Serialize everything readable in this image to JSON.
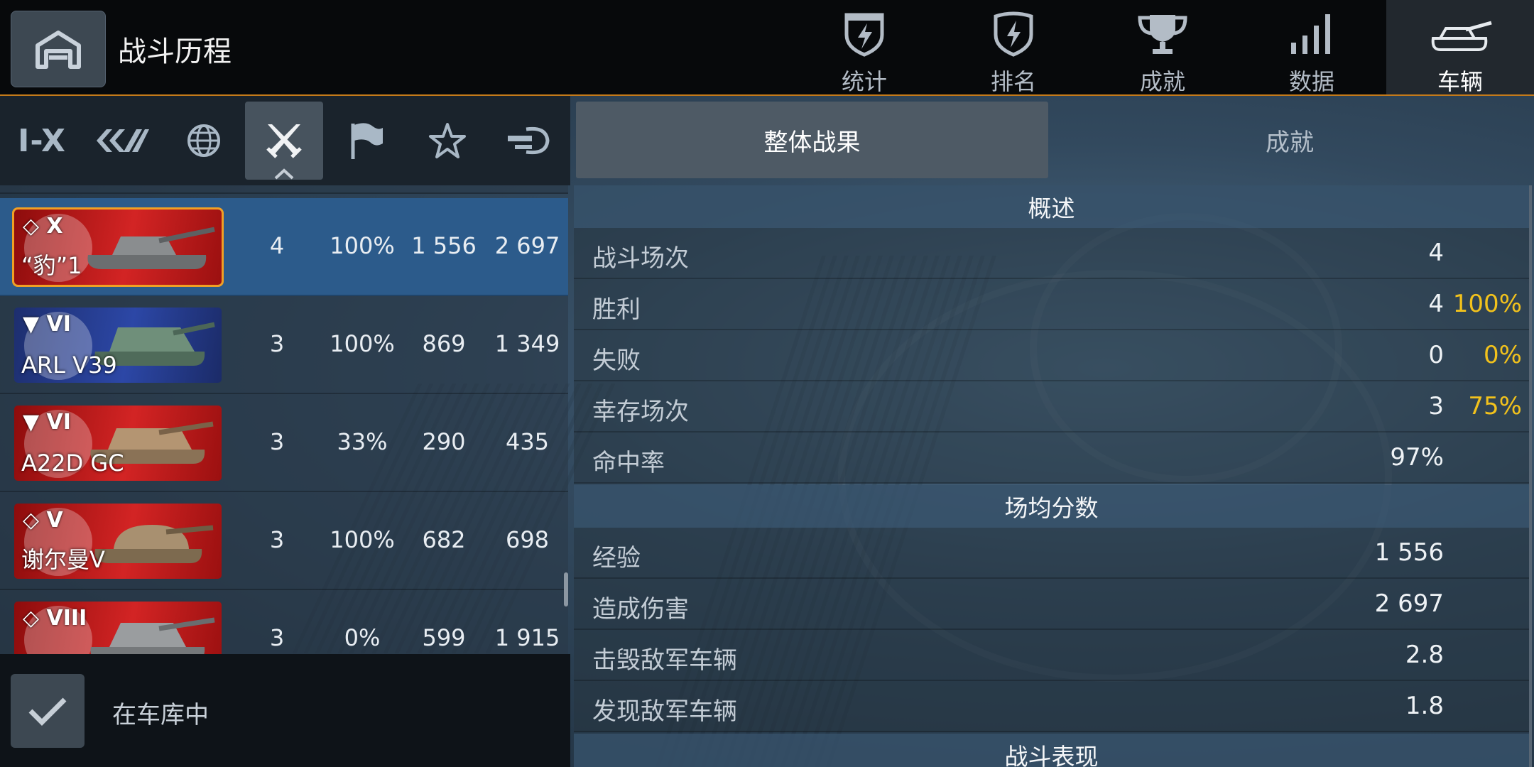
{
  "header": {
    "title": "战斗历程",
    "tabs": [
      {
        "label": "统计",
        "icon": "shield-bolt-icon"
      },
      {
        "label": "排名",
        "icon": "shield-icon"
      },
      {
        "label": "成就",
        "icon": "trophy-icon"
      },
      {
        "label": "数据",
        "icon": "bar-chart-icon"
      },
      {
        "label": "车辆",
        "icon": "tank-icon",
        "active": true
      }
    ]
  },
  "filters": {
    "tiers_label": "I-X",
    "items": [
      "tiers",
      "vehicle-class-icon",
      "globe-icon",
      "crossed-swords-icon",
      "flag-icon",
      "star-icon",
      "tank-gun-icon"
    ],
    "active": "crossed-swords-icon"
  },
  "vehicles": [
    {
      "name": "“豹”1",
      "tier": "X",
      "battles": "4",
      "win_rate": "100%",
      "avg_xp": "1 556",
      "avg_damage": "2 697",
      "nation_color": "#c81e1e",
      "selected": true
    },
    {
      "name": "ARL V39",
      "tier": "VI",
      "battles": "3",
      "win_rate": "100%",
      "avg_xp": "869",
      "avg_damage": "1 349",
      "nation_color": "#2c47a6"
    },
    {
      "name": "A22D GC",
      "tier": "VI",
      "battles": "3",
      "win_rate": "33%",
      "avg_xp": "290",
      "avg_damage": "435",
      "nation_color": "#c81e1e"
    },
    {
      "name": "谢尔曼V",
      "tier": "V",
      "battles": "3",
      "win_rate": "100%",
      "avg_xp": "682",
      "avg_damage": "698",
      "nation_color": "#c81e1e"
    },
    {
      "name": "",
      "tier": "VIII",
      "battles": "3",
      "win_rate": "0%",
      "avg_xp": "599",
      "avg_damage": "1 915",
      "nation_color": "#c81e1e"
    }
  ],
  "garage_filter": {
    "label": "在车库中",
    "checked": true
  },
  "right_tabs": {
    "overall": "整体战果",
    "achievements": "成就"
  },
  "sections": {
    "overview": {
      "title": "概述",
      "rows": [
        {
          "label": "战斗场次",
          "value": "4",
          "pct": ""
        },
        {
          "label": "胜利",
          "value": "4",
          "pct": "100%"
        },
        {
          "label": "失败",
          "value": "0",
          "pct": "0%"
        },
        {
          "label": "幸存场次",
          "value": "3",
          "pct": "75%"
        },
        {
          "label": "命中率",
          "value": "97%",
          "pct": ""
        }
      ]
    },
    "averages": {
      "title": "场均分数",
      "rows": [
        {
          "label": "经验",
          "value": "1 556"
        },
        {
          "label": "造成伤害",
          "value": "2 697"
        },
        {
          "label": "击毁敌军车辆",
          "value": "2.8"
        },
        {
          "label": "发现敌军车辆",
          "value": "1.8"
        }
      ]
    },
    "performance": {
      "title": "战斗表现"
    }
  },
  "colors": {
    "accent": "#f2c21c",
    "selected_row": "#2c5b8b",
    "border_accent": "#c47a1a"
  }
}
